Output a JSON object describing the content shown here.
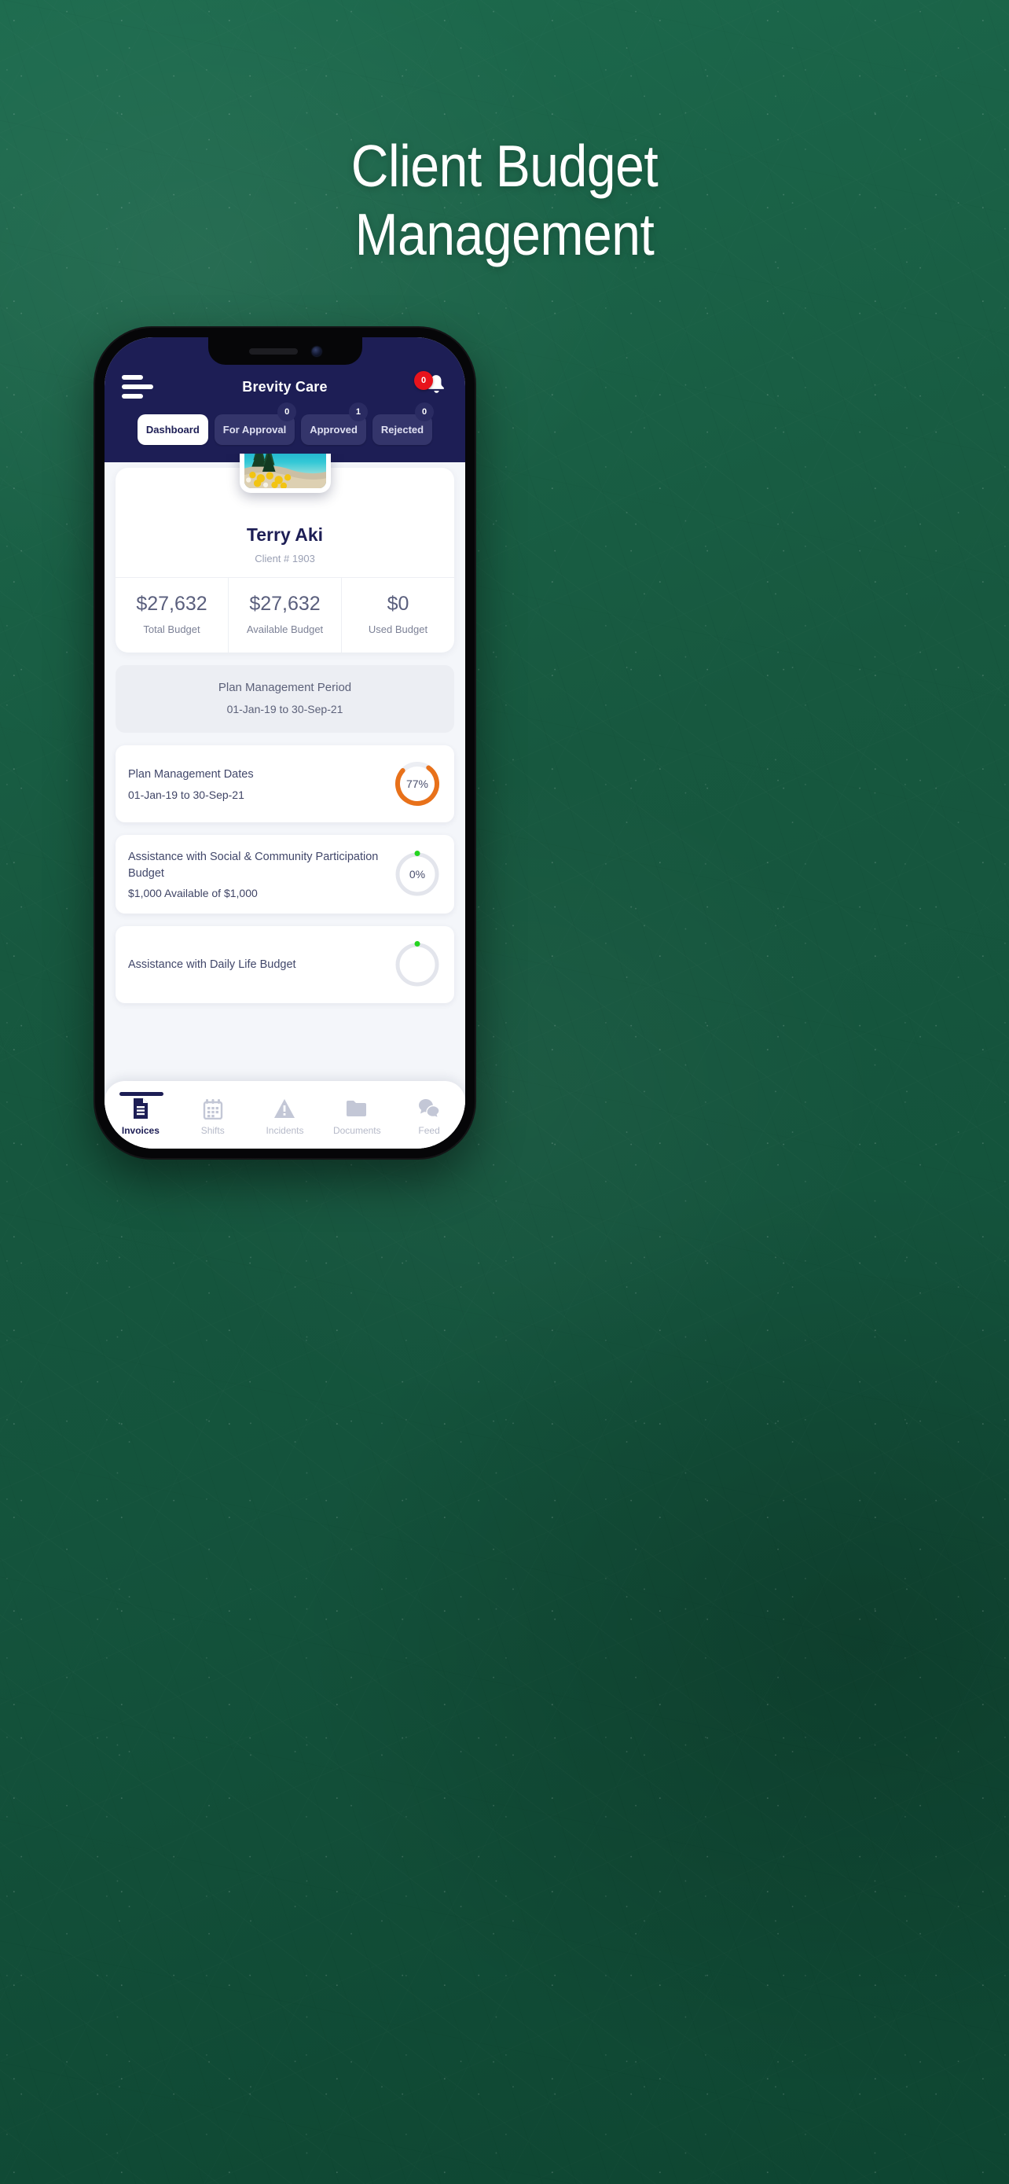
{
  "poster": {
    "headline_line1": "Client Budget",
    "headline_line2": "Management",
    "background_color": "#17583f"
  },
  "app": {
    "header": {
      "menu_icon": "hamburger-icon",
      "title": "Brevity Care",
      "notification_icon": "bell-icon",
      "notification_count": "0",
      "accent_color": "#1d1e55",
      "badge_color": "#e8131c"
    },
    "tabs": [
      {
        "label": "Dashboard",
        "badge": "",
        "active": true
      },
      {
        "label": "For Approval",
        "badge": "0",
        "active": false
      },
      {
        "label": "Approved",
        "badge": "1",
        "active": false
      },
      {
        "label": "Rejected",
        "badge": "0",
        "active": false
      }
    ],
    "profile": {
      "avatar_icon": "client-avatar-photo",
      "name": "Terry Aki",
      "client_id": "Client # 1903"
    },
    "stats": [
      {
        "value": "$27,632",
        "label": "Total Budget"
      },
      {
        "value": "$27,632",
        "label": "Available Budget"
      },
      {
        "value": "$0",
        "label": "Used Budget"
      }
    ],
    "period": {
      "title": "Plan Management Period",
      "value": "01-Jan-19 to 30-Sep-21"
    },
    "cards": [
      {
        "title": "Plan Management Dates",
        "subtitle": "01-Jan-19 to 30-Sep-21",
        "percent_label": "77%",
        "percent": 77,
        "ring_color": "#e8711a",
        "dot": false
      },
      {
        "title": "Assistance with Social & Community Participation Budget",
        "subtitle": "$1,000 Available of $1,000",
        "percent_label": "0%",
        "percent": 0,
        "ring_color": "#e3e5ec",
        "dot": true,
        "dot_color": "#25d420"
      },
      {
        "title": "Assistance with Daily Life Budget",
        "subtitle": "",
        "percent_label": "",
        "percent": 0,
        "ring_color": "#e3e5ec",
        "dot": true,
        "dot_color": "#25d420"
      }
    ],
    "bottom_nav": [
      {
        "label": "Invoices",
        "icon": "document-invoice-icon",
        "active": true
      },
      {
        "label": "Shifts",
        "icon": "calendar-icon",
        "active": false
      },
      {
        "label": "Incidents",
        "icon": "warning-triangle-icon",
        "active": false
      },
      {
        "label": "Documents",
        "icon": "folder-icon",
        "active": false
      },
      {
        "label": "Feed",
        "icon": "chat-bubbles-icon",
        "active": false
      }
    ]
  }
}
